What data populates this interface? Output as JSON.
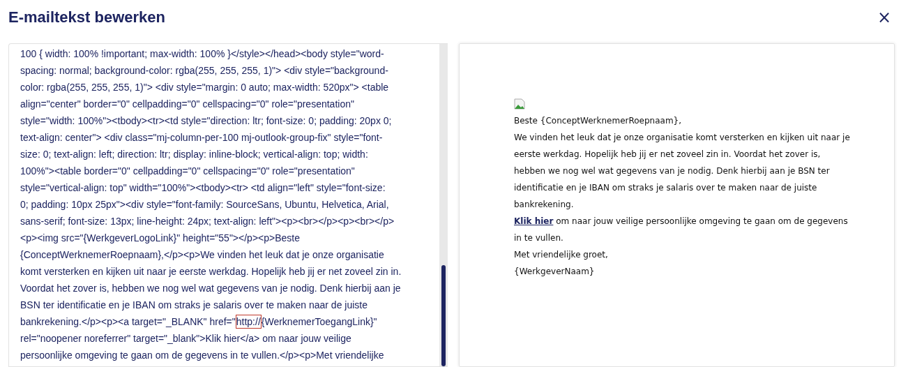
{
  "dialog": {
    "title": "E-mailtekst bewerken",
    "close": "×"
  },
  "source_editor": {
    "lines": [
      {
        "text": "100 { width: 100% !important; max-width: 100% }</style></head><body style=\"word-"
      },
      {
        "text": "spacing: normal; background-color: rgba(255, 255, 255, 1)\"> <div style=\"background-"
      },
      {
        "text": "color: rgba(255, 255, 255, 1)\"> <div style=\"margin: 0 auto; max-width: 520px\"> <table"
      },
      {
        "text": "align=\"center\" border=\"0\" cellpadding=\"0\" cellspacing=\"0\" role=\"presentation\""
      },
      {
        "text": "style=\"width: 100%\"><tbody><tr><td style=\"direction: ltr; font-size: 0; padding: 20px 0;"
      },
      {
        "text": "text-align: center\"> <div class=\"mj-column-per-100 mj-outlook-group-fix\" style=\"font-"
      },
      {
        "text": "size: 0; text-align: left; direction: ltr; display: inline-block; vertical-align: top; width:"
      },
      {
        "text": "100%\"><table border=\"0\" cellpadding=\"0\" cellspacing=\"0\" role=\"presentation\""
      },
      {
        "text": "style=\"vertical-align: top\" width=\"100%\"><tbody><tr> <td align=\"left\" style=\"font-size:"
      },
      {
        "text": "0; padding: 10px 25px\"><div style=\"font-family: SourceSans, Ubuntu, Helvetica, Arial,"
      },
      {
        "text": "sans-serif; font-size: 13px; line-height: 24px; text-align: left\"><p><br></p><p><br></p>"
      },
      {
        "text": "<p><img src=\"{WerkgeverLogoLink}\" height=\"55\"></p><p>Beste"
      },
      {
        "text": "{ConceptWerknemerRoepnaam},</p><p>We vinden het leuk dat je onze organisatie"
      },
      {
        "text": "komt versterken en kijken uit naar je eerste werkdag. Hopelijk heb jij er net zoveel zin in."
      },
      {
        "text": "Voordat het zover is, hebben we nog wel wat gegevens van je nodig. Denk hierbij aan je"
      },
      {
        "text": "BSN ter identificatie en je IBAN om straks je salaris over te maken naar de juiste"
      },
      {
        "text": "bankrekening.</p><p><a target=\"_BLANK\" href=\"",
        "marked": "http://",
        "after": "{WerknemerToegangLink}\""
      },
      {
        "text": "rel=\"noopener noreferrer\" target=\"_blank\">Klik hier</a> om naar jouw veilige"
      },
      {
        "text": "persoonlijke omgeving te gaan om de gegevens in te vullen.</p><p>Met vriendelijke"
      }
    ]
  },
  "preview": {
    "paragraphs": [
      {
        "text": "Beste {ConceptWerknemerRoepnaam},"
      },
      {
        "text": "We vinden het leuk dat je onze organisatie komt versterken en kijken uit naar je eerste werkdag. Hopelijk heb jij er net zoveel zin in. Voordat het zover is, hebben we nog wel wat gegevens van je nodig. Denk hierbij aan je BSN ter identificatie en je IBAN om straks je salaris over te maken naar de juiste bankrekening."
      },
      {
        "link": "Klik hier",
        "text": " om naar jouw veilige persoonlijke omgeving te gaan om de gegevens in te vullen."
      },
      {
        "text": "Met vriendelijke groet,"
      },
      {
        "text": "{WerkgeverNaam}"
      }
    ]
  }
}
